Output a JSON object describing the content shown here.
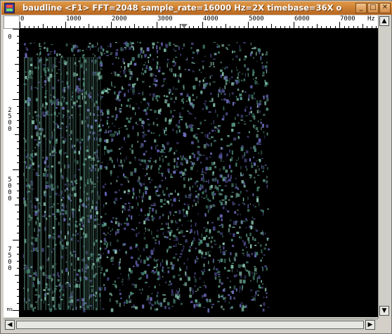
{
  "window": {
    "title": "baudline  <F1> FFT=2048 sample_rate=16000 Hz=2X timebase=36X  o",
    "buttons": {
      "minimize": "_",
      "maximize": "□",
      "close": "✕"
    }
  },
  "freq_ruler": {
    "labels": [
      "0",
      "1000",
      "2000",
      "3000",
      "4000",
      "5000",
      "6000",
      "7000",
      "Hz"
    ]
  },
  "time_ruler": {
    "labels": [
      "0",
      "2500",
      "5000",
      "7500",
      "ms"
    ]
  },
  "colors": {
    "accent": "#d08a40",
    "spectrogram_bg": "#000000",
    "signal": "#5ea08c"
  },
  "scroll": {
    "up": "▲",
    "down": "▼",
    "left": "◀",
    "right": "▶"
  }
}
